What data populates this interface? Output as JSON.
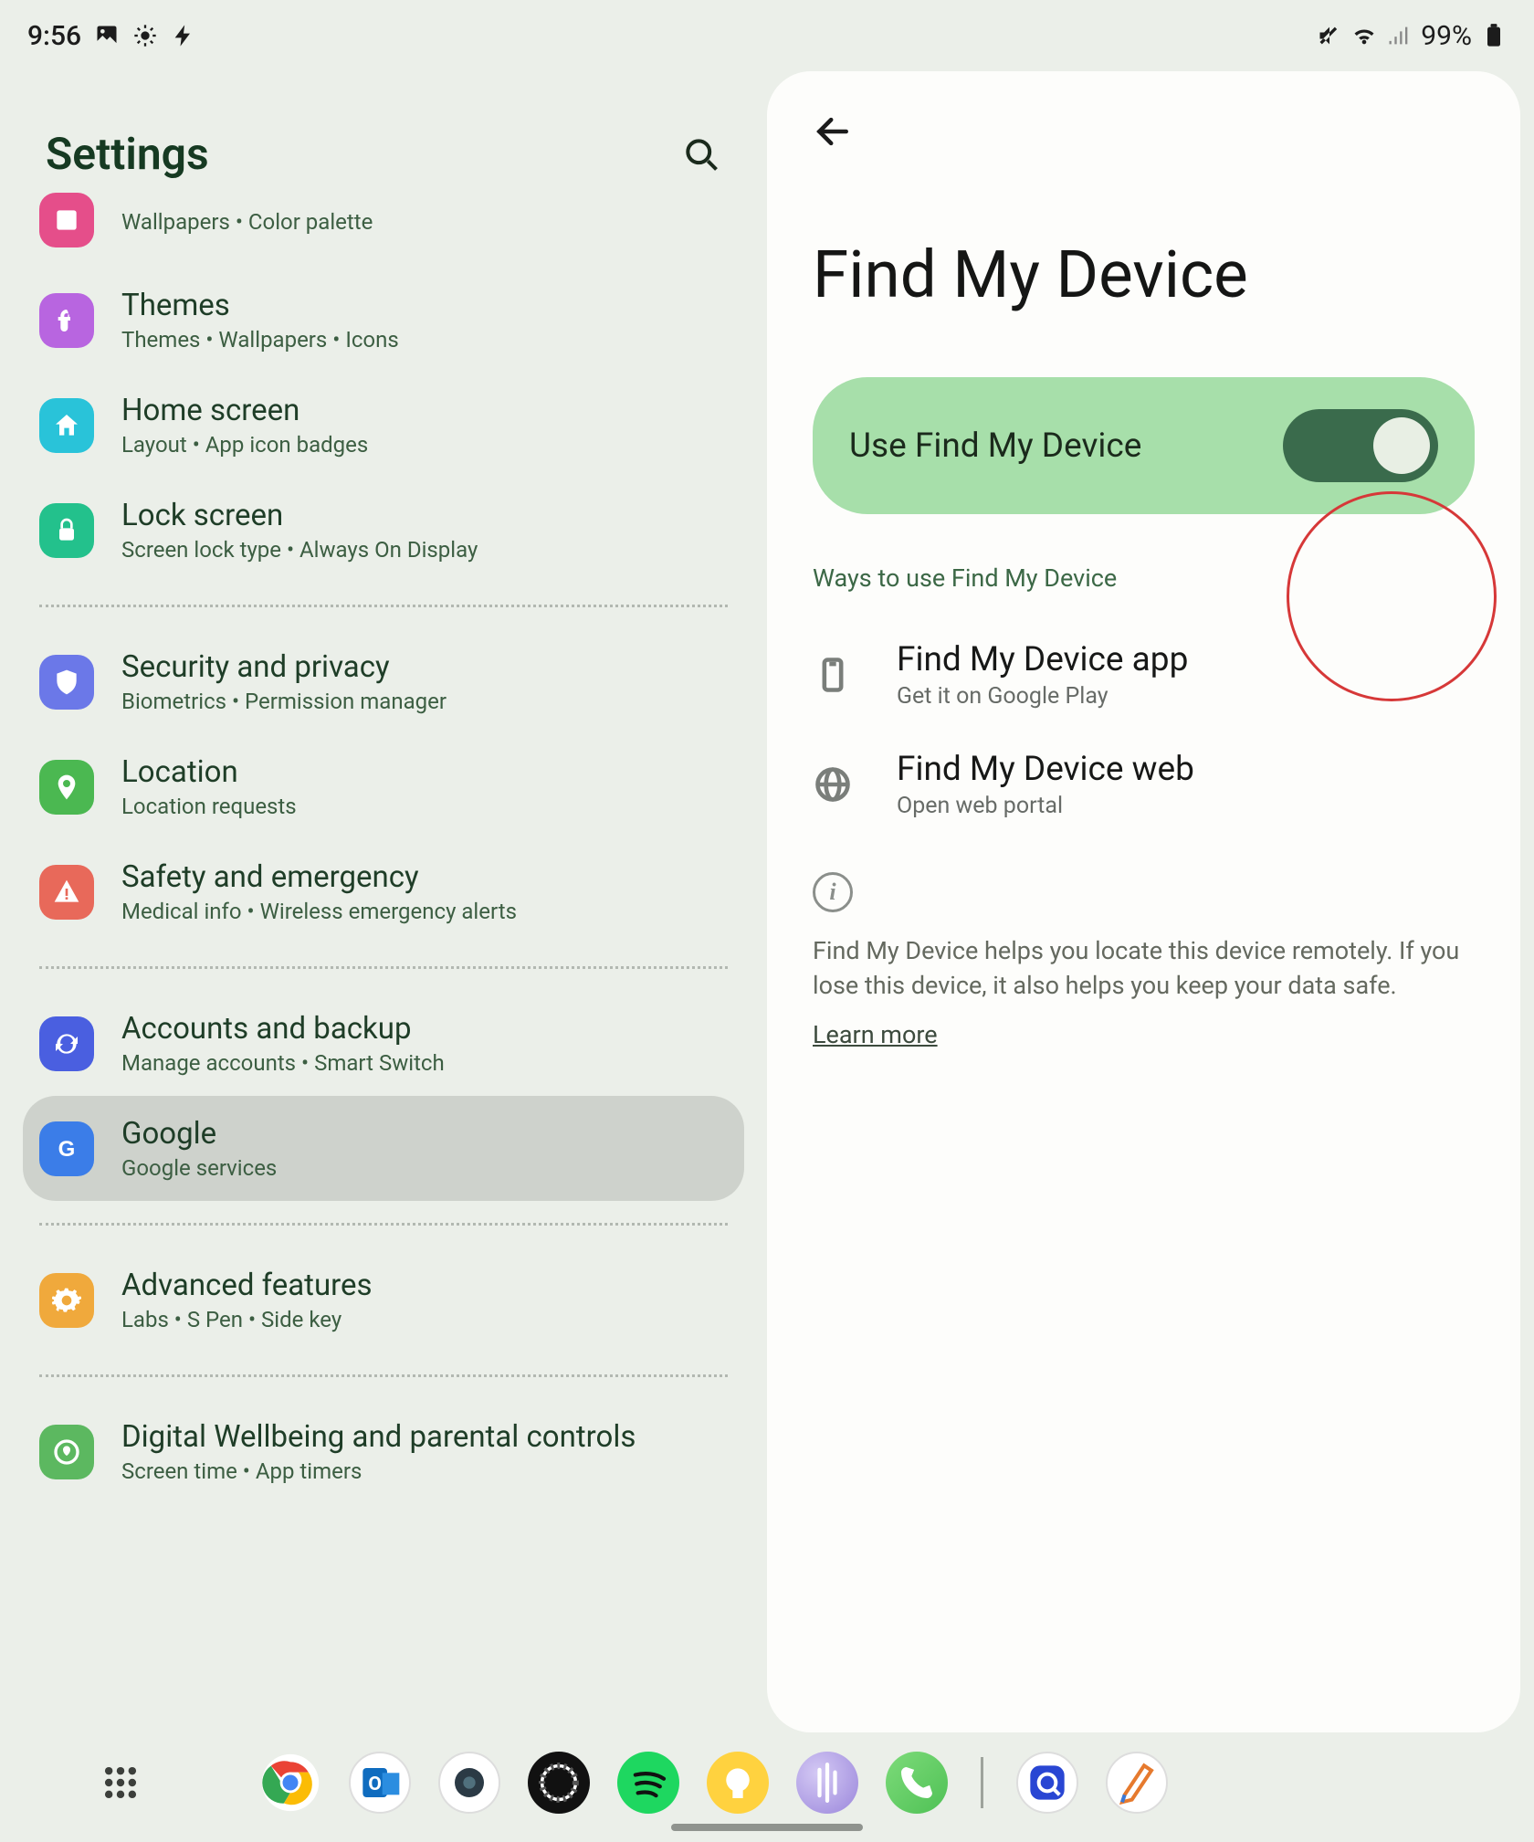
{
  "status": {
    "time": "9:56",
    "battery": "99%"
  },
  "settings": {
    "title": "Settings",
    "items": [
      {
        "t": "",
        "s": "Wallpapers  •  Color palette",
        "c": "#e54e8a",
        "ico": "wall",
        "cut": true
      },
      {
        "t": "Themes",
        "s": "Themes  •  Wallpapers  •  Icons",
        "c": "#b865e0",
        "ico": "themes"
      },
      {
        "t": "Home screen",
        "s": "Layout  •  App icon badges",
        "c": "#29c3d9",
        "ico": "home"
      },
      {
        "t": "Lock screen",
        "s": "Screen lock type  •  Always On Display",
        "c": "#23c18c",
        "ico": "lock"
      },
      "div",
      {
        "t": "Security and privacy",
        "s": "Biometrics  •  Permission manager",
        "c": "#6b78e8",
        "ico": "shield"
      },
      {
        "t": "Location",
        "s": "Location requests",
        "c": "#4bb851",
        "ico": "pin"
      },
      {
        "t": "Safety and emergency",
        "s": "Medical info  •  Wireless emergency alerts",
        "c": "#e8695a",
        "ico": "alert"
      },
      "div",
      {
        "t": "Accounts and backup",
        "s": "Manage accounts  •  Smart Switch",
        "c": "#4a5fe0",
        "ico": "sync"
      },
      {
        "t": "Google",
        "s": "Google services",
        "c": "#3b7de8",
        "ico": "google",
        "sel": true
      },
      "div",
      {
        "t": "Advanced features",
        "s": "Labs  •  S Pen  •  Side key",
        "c": "#f0a93c",
        "ico": "gear"
      },
      "div",
      {
        "t": "Digital Wellbeing and parental controls",
        "s": "Screen time  •  App timers",
        "c": "#5cb860",
        "ico": "well"
      }
    ]
  },
  "page": {
    "title": "Find My Device",
    "toggle_label": "Use Find My Device",
    "toggle_on": true,
    "section": "Ways to use Find My Device",
    "ways": [
      {
        "t": "Find My Device app",
        "s": "Get it on Google Play",
        "ico": "phone"
      },
      {
        "t": "Find My Device web",
        "s": "Open web portal",
        "ico": "globe"
      }
    ],
    "info": "Find My Device helps you locate this device remotely. If you lose this device, it also helps you keep your data safe.",
    "learn": "Learn more"
  },
  "dock": [
    {
      "name": "chrome",
      "c1": "#ea4335",
      "c2": "#fbbc05",
      "c3": "#34a853",
      "c4": "#4285f4"
    },
    {
      "name": "outlook",
      "c": "#fff",
      "brd": "#0f6cbf"
    },
    {
      "name": "cam",
      "c": "#2b3a45"
    },
    {
      "name": "watch",
      "c": "#111"
    },
    {
      "name": "spotify",
      "c": "#1ed760"
    },
    {
      "name": "tips",
      "c": "#ffd23f"
    },
    {
      "name": "bixby",
      "c": "#b7a8ec"
    },
    {
      "name": "phone",
      "c": "#5fcf6c"
    },
    "sep",
    {
      "name": "quick",
      "c": "#2946d3"
    },
    {
      "name": "note",
      "c": "#fff",
      "brd": "#e67a2e"
    }
  ]
}
